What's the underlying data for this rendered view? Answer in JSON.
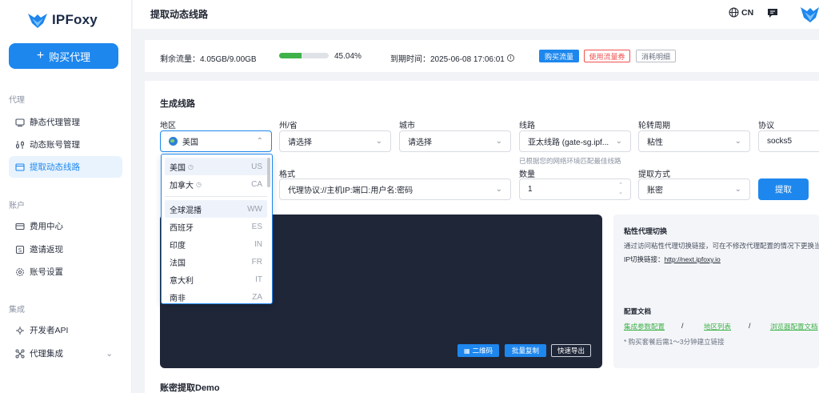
{
  "brand": {
    "name": "IPFoxy"
  },
  "sidebar": {
    "buy_button": "购买代理",
    "sections": [
      {
        "label": "代理",
        "items": [
          {
            "label": "静态代理管理"
          },
          {
            "label": "动态账号管理"
          },
          {
            "label": "提取动态线路"
          }
        ]
      },
      {
        "label": "账户",
        "items": [
          {
            "label": "费用中心"
          },
          {
            "label": "邀请返现"
          },
          {
            "label": "账号设置"
          }
        ]
      },
      {
        "label": "集成",
        "items": [
          {
            "label": "开发者API"
          },
          {
            "label": "代理集成"
          }
        ]
      }
    ]
  },
  "header": {
    "title": "提取动态线路",
    "language": "CN"
  },
  "status": {
    "traffic_label": "剩余流量：4.05GB/9.00GB",
    "progress_percent": 45.04,
    "progress_text": "45.04%",
    "expiry_label": "到期时间：2025-06-08 17:06:01",
    "buy_traffic": "购买流量",
    "use_coupon": "使用流量券",
    "consumption": "消耗明细"
  },
  "form": {
    "section_title": "生成线路",
    "region": {
      "label": "地区",
      "value": "美国"
    },
    "state": {
      "label": "州/省",
      "value": "请选择"
    },
    "city": {
      "label": "城市",
      "value": "请选择"
    },
    "route": {
      "label": "线路",
      "value": "亚太线路 (gate-sg.ipf...",
      "hint": "已根据您的网络环境匹配最佳线路"
    },
    "rotation": {
      "label": "轮转周期",
      "value": "粘性"
    },
    "protocol": {
      "label": "协议",
      "value": "socks5"
    },
    "format": {
      "label": "格式",
      "value": "代理协议://主机IP:端口:用户名:密码"
    },
    "quantity": {
      "label": "数量",
      "value": "1"
    },
    "method": {
      "label": "提取方式",
      "value": "账密"
    },
    "extract_button": "提取"
  },
  "output": {
    "qr_button": "二维码",
    "batch_copy": "批量复制",
    "export": "快速导出"
  },
  "info": {
    "sticky_title": "粘性代理切换",
    "sticky_desc": "通过访问粘性代理切换链接，可在不修改代理配置的情况下更换当前",
    "ip_switch_label": "IP切换链接：",
    "ip_switch_link": "http://next.ipfoxy.io",
    "docs_title": "配置文档",
    "doc_links": [
      "集成参数配置",
      "地区列表",
      "浏览器配置文档"
    ],
    "sep": "/",
    "note": "* 购买套餐后需1～3分钟建立链接"
  },
  "demo_title": "账密提取Demo",
  "dropdown": {
    "items": [
      {
        "name": "美国",
        "code": "US",
        "clock": true
      },
      {
        "name": "加拿大",
        "code": "CA",
        "clock": true
      },
      {
        "name": "全球混播",
        "code": "WW",
        "clock": false
      },
      {
        "name": "西班牙",
        "code": "ES",
        "clock": false
      },
      {
        "name": "印度",
        "code": "IN",
        "clock": false
      },
      {
        "name": "法国",
        "code": "FR",
        "clock": false
      },
      {
        "name": "意大利",
        "code": "IT",
        "clock": false
      },
      {
        "name": "南非",
        "code": "ZA",
        "clock": false
      }
    ]
  },
  "colors": {
    "accent": "#1d87ee",
    "progress": "#3fb24a",
    "danger": "#f0504f",
    "dark_panel": "#1f2638"
  }
}
